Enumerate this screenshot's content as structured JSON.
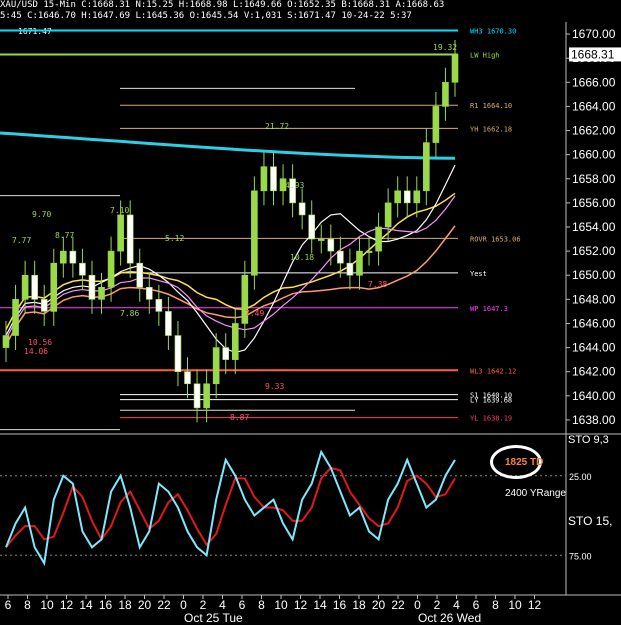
{
  "header": {
    "line1": "XAU/USD  15-Min  C:1668.31  N:15.25  H:1668.98  L:1649.66  O:1652.35  B:1668.31  A:1668.63",
    "line2": "5:45  C:1646.70  H:1647.69  L:1645.36  O:1645.54  V:1,031  S:1671.47  10-24-22  5:37"
  },
  "price_axis": {
    "ticks": [
      "1670.00",
      "1668.00",
      "1666.00",
      "1664.00",
      "1662.00",
      "1660.00",
      "1658.00",
      "1656.00",
      "1654.00",
      "1652.00",
      "1650.00",
      "1648.00",
      "1646.00",
      "1644.00",
      "1642.00",
      "1640.00",
      "1638.00"
    ],
    "current": "1668.31",
    "top_left_value": "1671.47"
  },
  "stoch_axis": {
    "label_top": "STO  9,3",
    "label": "STO  15,",
    "ticks": [
      "25.00",
      "75.00"
    ]
  },
  "time_axis": {
    "hours": [
      "6",
      "8",
      "10",
      "12",
      "14",
      "16",
      "18",
      "20",
      "22",
      "0",
      "2",
      "4",
      "6",
      "8",
      "10",
      "12",
      "14",
      "16",
      "18",
      "20",
      "22",
      "0",
      "2",
      "4",
      "6",
      "8",
      "10",
      "12"
    ],
    "dates": [
      "Oct 25 Tue",
      "Oct 26 Wed"
    ]
  },
  "levels": [
    {
      "label": "WH3  1670.30",
      "price": 1670.3,
      "color": "#00e5ff"
    },
    {
      "label": "LW High",
      "price": 1668.31,
      "color": "#9ad94a"
    },
    {
      "label": "R1  1664.10",
      "price": 1664.1,
      "color": "#d8b070"
    },
    {
      "label": "YH  1662.18",
      "price": 1662.18,
      "color": "#d8b070"
    },
    {
      "label": "ROVR  1653.06",
      "price": 1653.06,
      "color": "#d8b070"
    },
    {
      "label": "Yest",
      "price": 1650.2,
      "color": "#ffffff"
    },
    {
      "label": "WP  1647.3",
      "price": 1647.3,
      "color": "#ff40ff"
    },
    {
      "label": "WL3  1642.12",
      "price": 1642.12,
      "color": "#ff6040"
    },
    {
      "label": "S1  1640.10",
      "price": 1640.1,
      "color": "#ffffff"
    },
    {
      "label": "LY  1639.68",
      "price": 1639.68,
      "color": "#ffffff"
    },
    {
      "label": "YL  1638.19",
      "price": 1638.19,
      "color": "#ff4060"
    }
  ],
  "swing_labels": [
    "19.32",
    "21.72",
    "4.93",
    "9.70",
    "7.10",
    "7.77",
    "8.77",
    "5.12",
    "10.18",
    "7.38",
    "7.86",
    "7.49",
    "10.56",
    "14.06",
    "8.87",
    "9.33"
  ],
  "annotation": {
    "td": "1825 TD",
    "range": "2400 YRange"
  },
  "chart_data": {
    "type": "candlestick",
    "title": "",
    "y_range": [
      1637,
      1671
    ],
    "price_path": [
      1645,
      1648,
      1650,
      1648,
      1647,
      1651,
      1652,
      1651,
      1650,
      1648,
      1649,
      1652,
      1655,
      1651,
      1649,
      1648,
      1647,
      1645,
      1642,
      1641,
      1639,
      1641,
      1644,
      1643,
      1646,
      1650,
      1657,
      1659,
      1657,
      1658,
      1656,
      1655,
      1653,
      1653,
      1652,
      1651,
      1650,
      1652,
      1652,
      1654,
      1656,
      1657,
      1656,
      1657,
      1661,
      1664,
      1666,
      1668.31
    ],
    "stoch_path": [
      30,
      45,
      55,
      30,
      20,
      60,
      75,
      70,
      40,
      30,
      35,
      65,
      75,
      55,
      30,
      40,
      70,
      65,
      55,
      40,
      30,
      25,
      60,
      85,
      75,
      60,
      50,
      55,
      60,
      45,
      35,
      60,
      70,
      90,
      80,
      65,
      50,
      55,
      40,
      35,
      60,
      70,
      85,
      70,
      55,
      60,
      75,
      85
    ]
  }
}
